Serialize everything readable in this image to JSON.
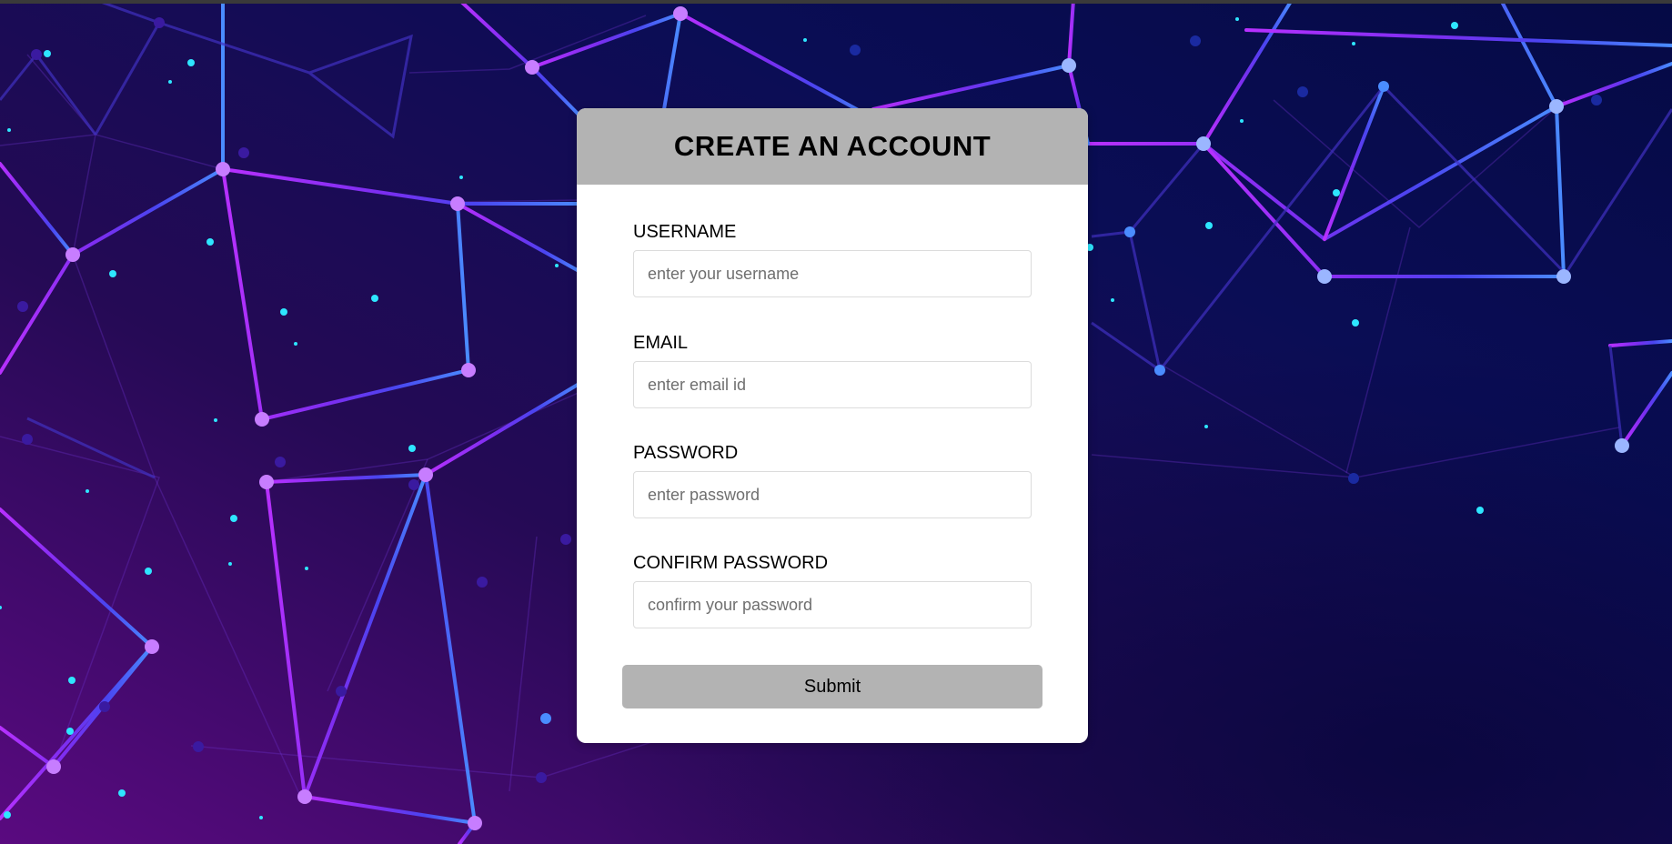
{
  "colors": {
    "header_bg": "#b3b3b3",
    "card_bg": "#ffffff",
    "button_bg": "#b3b3b3",
    "bg_purple": "#5a0a80",
    "bg_navy": "#050a45",
    "node_purple": "#c77dff",
    "node_blue": "#9bb6ff",
    "dot_cyan": "#2ee6ff"
  },
  "form": {
    "title": "CREATE AN ACCOUNT",
    "fields": [
      {
        "label": "USERNAME",
        "placeholder": "enter your username",
        "value": ""
      },
      {
        "label": "EMAIL",
        "placeholder": "enter email id",
        "value": ""
      },
      {
        "label": "PASSWORD",
        "placeholder": "enter password",
        "value": ""
      },
      {
        "label": "CONFIRM PASSWORD",
        "placeholder": "confirm your password",
        "value": ""
      }
    ],
    "submit_label": "Submit"
  },
  "background": {
    "pattern": "network-nodes"
  }
}
